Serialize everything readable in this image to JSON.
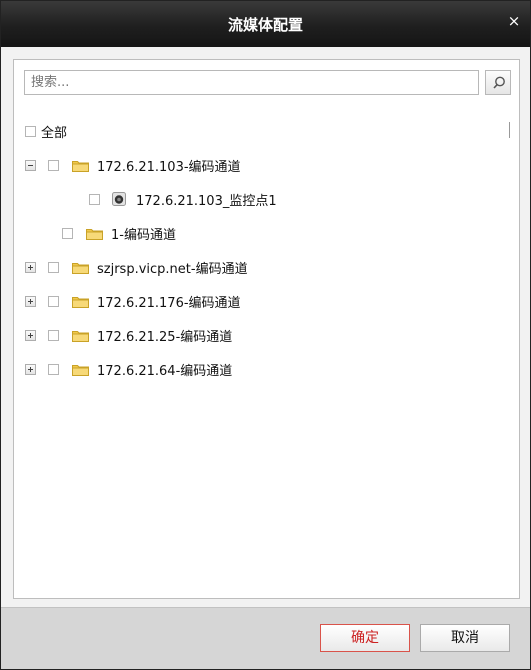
{
  "dialog": {
    "title": "流媒体配置",
    "close_glyph": "×"
  },
  "search": {
    "placeholder": "搜索...",
    "icon": "search-icon"
  },
  "tree": {
    "root_label": "全部",
    "nodes": [
      {
        "label": "172.6.21.103-编码通道",
        "expander": "minus",
        "icon": "folder-icon"
      },
      {
        "label": "172.6.21.103_监控点1",
        "expander": "none",
        "icon": "camera-icon"
      },
      {
        "label": "1-编码通道",
        "expander": "none",
        "icon": "folder-icon"
      },
      {
        "label": "szjrsp.vicp.net-编码通道",
        "expander": "plus",
        "icon": "folder-icon"
      },
      {
        "label": "172.6.21.176-编码通道",
        "expander": "plus",
        "icon": "folder-icon"
      },
      {
        "label": "172.6.21.25-编码通道",
        "expander": "plus",
        "icon": "folder-icon"
      },
      {
        "label": "172.6.21.64-编码通道",
        "expander": "plus",
        "icon": "folder-icon"
      }
    ]
  },
  "buttons": {
    "ok_label": "确定",
    "cancel_label": "取消"
  },
  "colors": {
    "titlebar": "#1f1f1f",
    "folder": "#f2c94c",
    "ok_border": "#d9534a"
  }
}
